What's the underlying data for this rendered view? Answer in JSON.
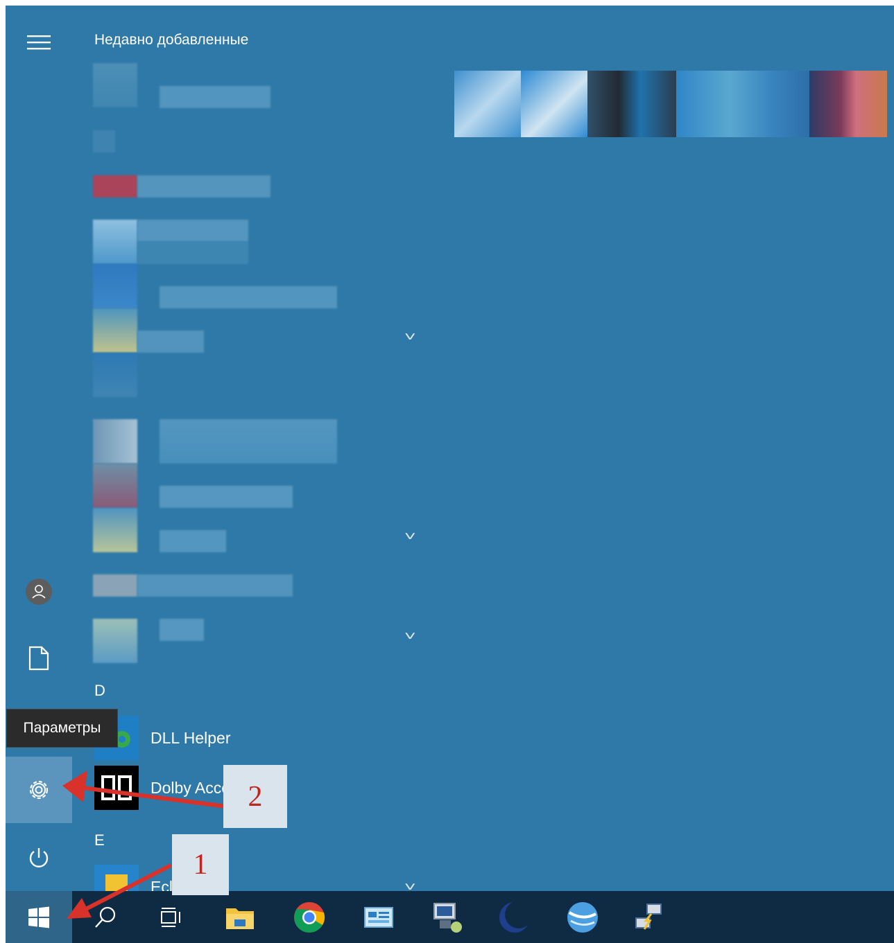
{
  "start_menu": {
    "section_title": "Недавно добавленные",
    "letters": [
      "D",
      "E"
    ],
    "apps": [
      {
        "name": "DLL Helper",
        "icon": "dll-helper-icon"
      },
      {
        "name": "Dolby Access",
        "icon": "dolby-icon"
      },
      {
        "name": "Eclipse",
        "icon": "eclipse-icon"
      }
    ]
  },
  "rail": {
    "items": [
      "menu-icon",
      "account-icon",
      "documents-icon",
      "settings-icon",
      "power-icon"
    ],
    "tooltip": "Параметры"
  },
  "annotations": {
    "badge_1": "1",
    "badge_2": "2"
  },
  "taskbar": {
    "items": [
      "windows-start-icon",
      "search-icon",
      "task-view-icon",
      "file-explorer-icon",
      "chrome-icon",
      "control-panel-icon",
      "remote-app-icon",
      "moon-app-icon",
      "sphere-app-icon",
      "network-app-icon"
    ]
  },
  "colors": {
    "menu_bg": "#2f79a8",
    "taskbar_bg": "#0f2b44",
    "active_bg": "#5b95bd",
    "tooltip_bg": "#2b2b2b",
    "arrow": "#d8322a"
  }
}
